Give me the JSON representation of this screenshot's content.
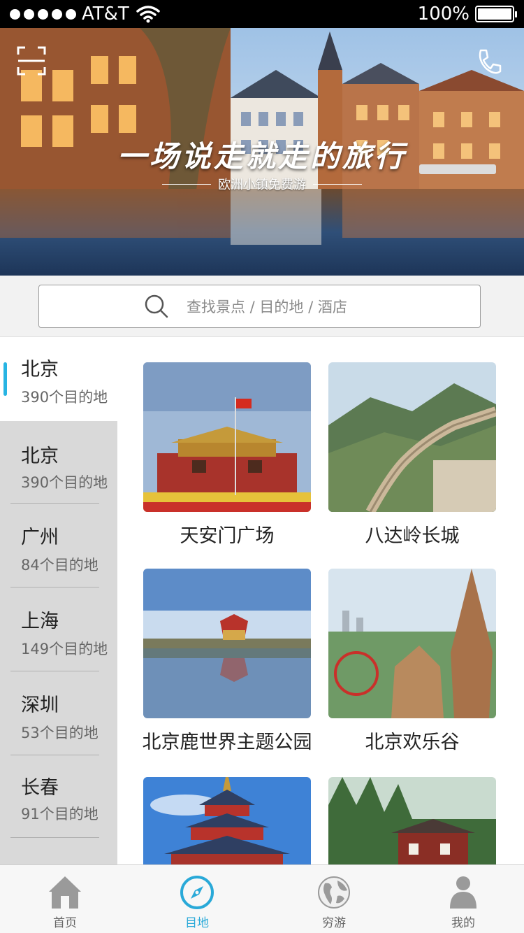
{
  "status_bar": {
    "carrier": "AT&T",
    "battery": "100%"
  },
  "hero": {
    "title": "一场说走就走的旅行",
    "subtitle": "欧洲小镇免费游"
  },
  "search": {
    "placeholder": "查找景点 / 目的地 / 酒店"
  },
  "sidebar": {
    "active": {
      "name": "北京",
      "count": "390个目的地"
    },
    "cities": [
      {
        "name": "北京",
        "count": "390个目的地"
      },
      {
        "name": "广州",
        "count": "84个目的地"
      },
      {
        "name": "上海",
        "count": "149个目的地"
      },
      {
        "name": "深圳",
        "count": "53个目的地"
      },
      {
        "name": "长春",
        "count": "91个目的地"
      }
    ]
  },
  "attractions": [
    {
      "name": "天安门广场"
    },
    {
      "name": "八达岭长城"
    },
    {
      "name": "北京鹿世界主题公园"
    },
    {
      "name": "北京欢乐谷"
    },
    {
      "name": ""
    },
    {
      "name": ""
    }
  ],
  "tabbar": {
    "items": [
      {
        "label": "首页"
      },
      {
        "label": "目地"
      },
      {
        "label": "穷游"
      },
      {
        "label": "我的"
      }
    ]
  },
  "colors": {
    "accent": "#29a9d8",
    "sidebar_bg": "#d9d9d9",
    "indicator": "#27b4e3"
  }
}
